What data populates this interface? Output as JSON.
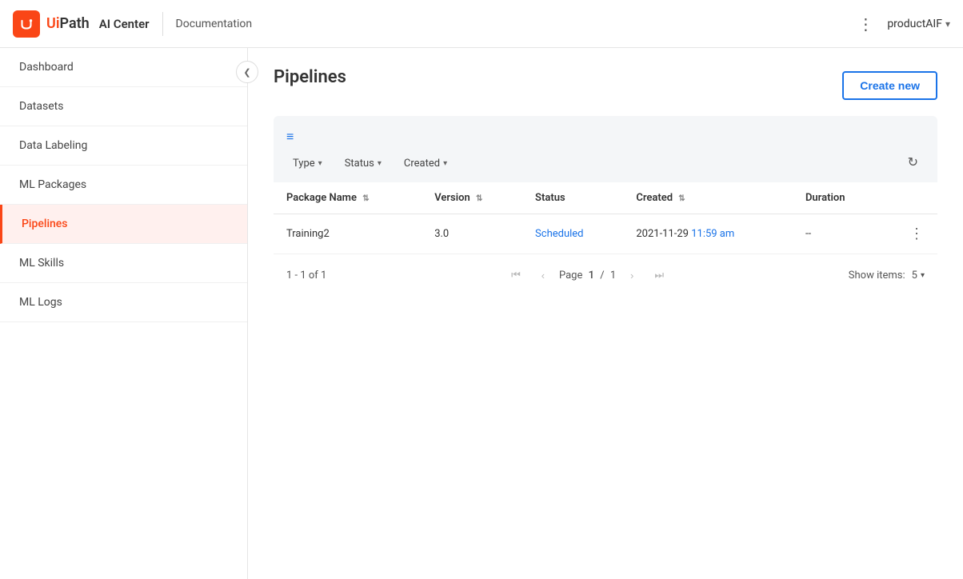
{
  "header": {
    "logo_alt": "UiPath",
    "ai_center": "AI Center",
    "doc_link": "Documentation",
    "three_dots": "⋮",
    "user": "productAIF",
    "chevron": "▾"
  },
  "sidebar": {
    "items": [
      {
        "id": "dashboard",
        "label": "Dashboard",
        "active": false
      },
      {
        "id": "datasets",
        "label": "Datasets",
        "active": false
      },
      {
        "id": "data-labeling",
        "label": "Data Labeling",
        "active": false
      },
      {
        "id": "ml-packages",
        "label": "ML Packages",
        "active": false
      },
      {
        "id": "pipelines",
        "label": "Pipelines",
        "active": true
      },
      {
        "id": "ml-skills",
        "label": "ML Skills",
        "active": false
      },
      {
        "id": "ml-logs",
        "label": "ML Logs",
        "active": false
      }
    ],
    "collapse_icon": "❮"
  },
  "main": {
    "page_title": "Pipelines",
    "create_btn": "Create new",
    "filter_icon": "≡",
    "filters": [
      {
        "label": "Type",
        "arrow": "▾"
      },
      {
        "label": "Status",
        "arrow": "▾"
      },
      {
        "label": "Created",
        "arrow": "▾"
      }
    ],
    "table": {
      "columns": [
        {
          "id": "package_name",
          "label": "Package Name",
          "sort": "⇅"
        },
        {
          "id": "version",
          "label": "Version",
          "sort": "⇅"
        },
        {
          "id": "status",
          "label": "Status"
        },
        {
          "id": "created",
          "label": "Created",
          "sort": "⇅"
        },
        {
          "id": "duration",
          "label": "Duration"
        }
      ],
      "rows": [
        {
          "package_name": "Training2",
          "version": "3.0",
          "status": "Scheduled",
          "created_date": "2021-11-29 ",
          "created_time": "11:59 am",
          "duration": "--"
        }
      ]
    },
    "pagination": {
      "info": "1 - 1 of 1",
      "page_label": "Page",
      "current_page": "1",
      "total_pages": "1",
      "show_items_label": "Show items:",
      "items_per_page": "5"
    }
  }
}
